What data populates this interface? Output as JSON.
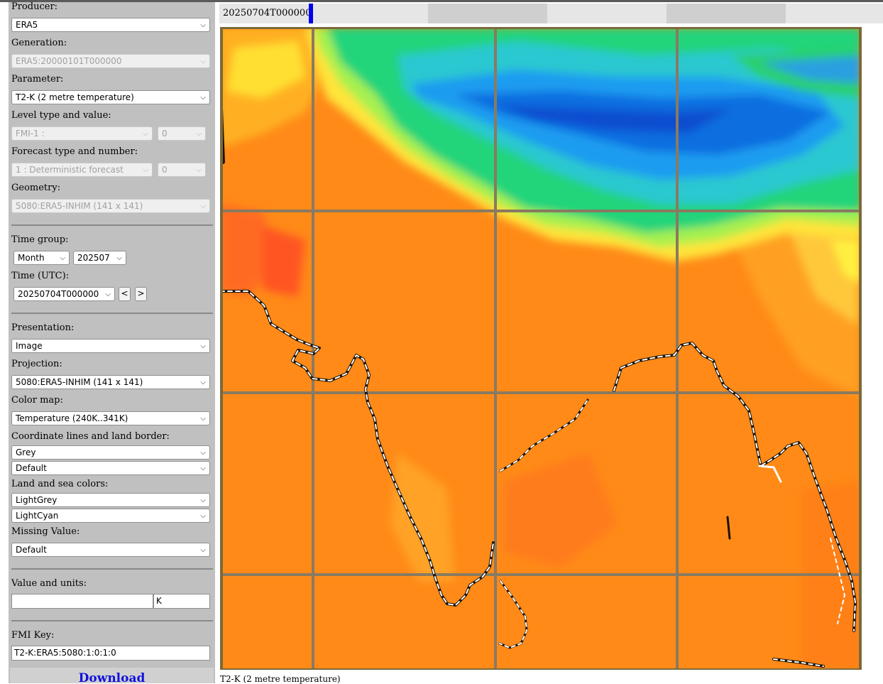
{
  "sidebar": {
    "producer": {
      "label": "Producer:",
      "value": "ERA5"
    },
    "generation": {
      "label": "Generation:",
      "value": "ERA5:20000101T000000"
    },
    "parameter": {
      "label": "Parameter:",
      "value": "T2-K (2 metre temperature)"
    },
    "level": {
      "label": "Level type and value:",
      "type": "FMI-1 :",
      "value": "0"
    },
    "forecast": {
      "label": "Forecast type and number:",
      "type": "1 : Deterministic forecast",
      "number": "0"
    },
    "geometry": {
      "label": "Geometry:",
      "value": "5080:ERA5-INHIM (141 x 141)"
    },
    "time_group": {
      "label": "Time group:",
      "period": "Month",
      "value": "202507"
    },
    "time_utc": {
      "label": "Time (UTC):",
      "value": "20250704T000000",
      "prev": "<",
      "next": ">"
    },
    "presentation": {
      "label": "Presentation:",
      "value": "Image"
    },
    "projection": {
      "label": "Projection:",
      "value": "5080:ERA5-INHIM (141 x 141)"
    },
    "color_map": {
      "label": "Color map:",
      "value": "Temperature (240K..341K)"
    },
    "coord_lines": {
      "label": "Coordinate lines and land border:",
      "lines": "Grey",
      "border": "Default"
    },
    "land_sea": {
      "label": "Land and sea colors:",
      "land": "LightGrey",
      "sea": "LightCyan"
    },
    "missing": {
      "label": "Missing Value:",
      "value": "Default"
    },
    "value_units": {
      "label": "Value and units:",
      "value": "",
      "units": "K"
    },
    "fmi_key": {
      "label": "FMI Key:",
      "value": "T2-K:ERA5:5080:1:0:1:0"
    },
    "download": "Download"
  },
  "timeline": {
    "label": "20250704T000000"
  },
  "map": {
    "caption": "T2-K (2 metre temperature)"
  },
  "colors": {
    "sidebar_bg": "#c0c0c0",
    "download_text": "#1010e0",
    "timeline_marker": "#0000ee"
  }
}
